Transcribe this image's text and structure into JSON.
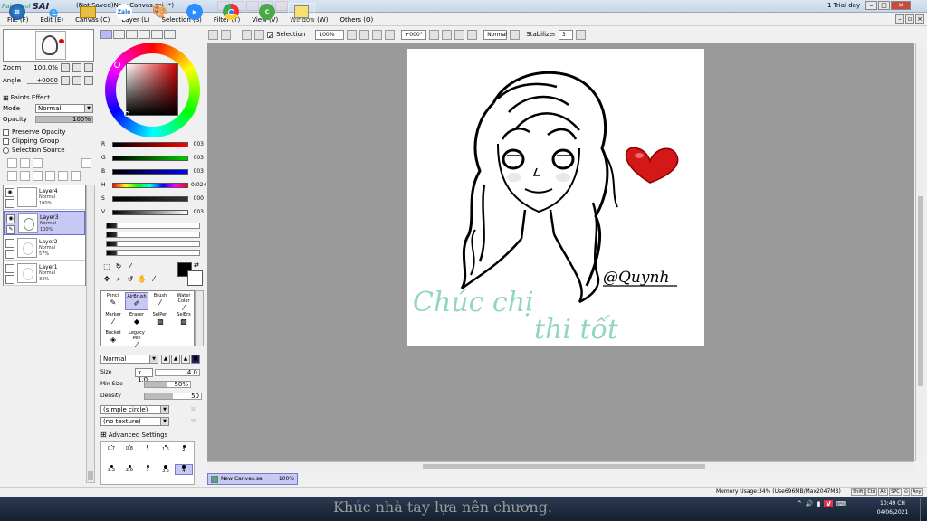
{
  "window": {
    "app_name_prefix": "PaintTool",
    "app_name": "SAI",
    "title": "(Not Saved)New Canvas.sai (*)",
    "trial": "1 Trial day"
  },
  "menu": [
    "File (F)",
    "Edit (E)",
    "Canvas (C)",
    "Layer (L)",
    "Selection (S)",
    "Filter (T)",
    "View (V)",
    "Window (W)",
    "Others (O)"
  ],
  "navigator": {
    "zoom_label": "Zoom",
    "zoom_value": "100.0%",
    "angle_label": "Angle",
    "angle_value": "+0000"
  },
  "paints_effect": {
    "header": "Paints Effect",
    "mode_label": "Mode",
    "mode_value": "Normal",
    "opacity_label": "Opacity",
    "opacity_value": "100%",
    "preserve_opacity": "Preserve Opacity",
    "clipping_group": "Clipping Group",
    "selection_source": "Selection Source"
  },
  "layers": [
    {
      "name": "Layer4",
      "mode": "Normal",
      "opacity": "100%",
      "selected": false
    },
    {
      "name": "Layer3",
      "mode": "Normal",
      "opacity": "100%",
      "selected": true
    },
    {
      "name": "Layer2",
      "mode": "Normal",
      "opacity": "57%",
      "selected": false
    },
    {
      "name": "Layer1",
      "mode": "Normal",
      "opacity": "33%",
      "selected": false
    }
  ],
  "color": {
    "r_label": "R",
    "r_value": "003",
    "g_label": "G",
    "g_value": "003",
    "b_label": "B",
    "b_value": "003",
    "h_label": "H",
    "h_value": "0:024",
    "s_label": "S",
    "s_value": "000",
    "v_label": "V",
    "v_value": "003",
    "primary": "#030303",
    "secondary": "#ffffff"
  },
  "brush_tools": [
    {
      "label": "Pencil",
      "icon": "pencil-icon"
    },
    {
      "label": "AirBrush",
      "icon": "airbrush-icon",
      "selected": true
    },
    {
      "label": "Brush",
      "icon": "brush-icon"
    },
    {
      "label": "Water Color",
      "icon": "watercolor-icon"
    },
    {
      "label": "Marker",
      "icon": "marker-icon"
    },
    {
      "label": "Eraser",
      "icon": "eraser-icon"
    },
    {
      "label": "SelPen",
      "icon": "selpen-icon"
    },
    {
      "label": "SelErs",
      "icon": "selers-icon"
    },
    {
      "label": "Bucket",
      "icon": "bucket-icon"
    },
    {
      "label": "Legacy Pen",
      "icon": "legacy-pen-icon"
    }
  ],
  "brush_props": {
    "blend_mode": "Normal",
    "size_label": "Size",
    "size_mult": "x 1.0",
    "size_value": "4.0",
    "min_size_label": "Min Size",
    "min_size_value": "50%",
    "density_label": "Density",
    "density_value": "50",
    "shape": "(simple circle)",
    "shape_value": "50",
    "texture": "(no texture)",
    "texture_value": "95",
    "advanced": "Advanced Settings"
  },
  "brush_sizes": [
    "0.7",
    "0.8",
    "1",
    "1.5",
    "2",
    "2.3",
    "2.6",
    "3",
    "3.5",
    "4"
  ],
  "canvas_toolbar": {
    "selection_label": "Selection",
    "zoom": "100%",
    "angle": "+000°",
    "mode": "Normal",
    "stabilizer_label": "Stabilizer",
    "stabilizer_value": "3"
  },
  "canvas_tab": {
    "name": "New Canvas.sai",
    "zoom": "100%"
  },
  "artwork": {
    "text_line1": "Chúc chị",
    "text_line2": "thi tốt",
    "signature": "@Quynh"
  },
  "status": {
    "memory": "Memory Usage:34% (Use696MB/Max2047MB)",
    "keys": [
      "Shift",
      "Ctrl",
      "Alt",
      "SPC",
      "⊙",
      "Any"
    ]
  },
  "taskbar": {
    "overlay_text": "Khúc nhà tay lựa nên chương.",
    "time": "10:49 CH",
    "date": "04/06/2021",
    "zalo_label": "Zalo"
  }
}
